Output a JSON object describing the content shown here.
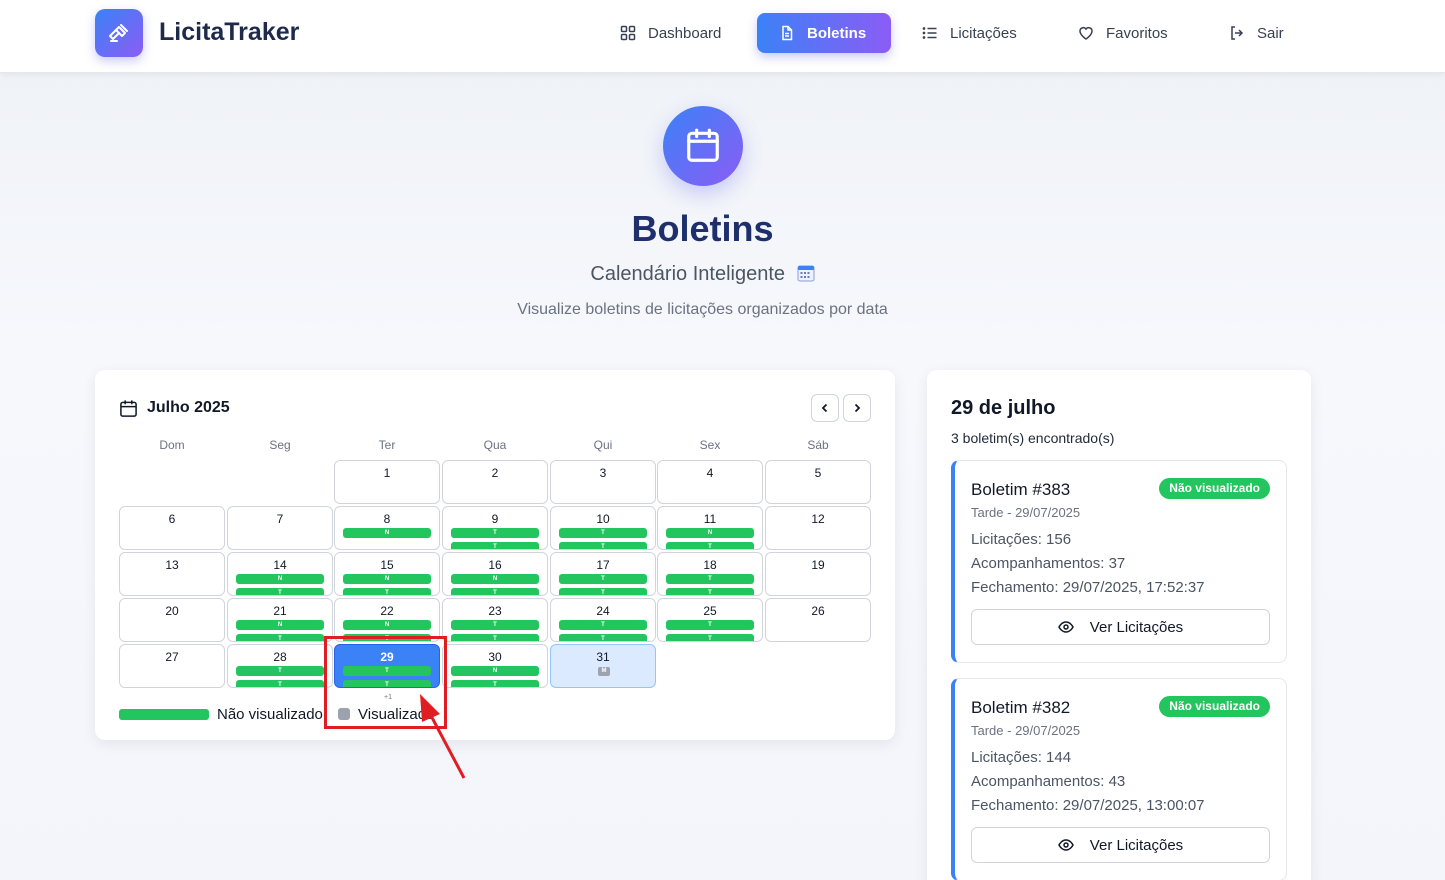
{
  "header": {
    "brand": "LicitaTraker",
    "nav": [
      {
        "label": "Dashboard",
        "icon": "dashboard-grid-icon"
      },
      {
        "label": "Boletins",
        "icon": "document-icon",
        "active": true
      },
      {
        "label": "Licitações",
        "icon": "list-icon"
      },
      {
        "label": "Favoritos",
        "icon": "heart-icon"
      },
      {
        "label": "Sair",
        "icon": "logout-icon"
      }
    ]
  },
  "hero": {
    "title": "Boletins",
    "subtitle": "Calendário Inteligente",
    "description": "Visualize boletins de licitações organizados por data"
  },
  "calendar": {
    "month_label": "Julho 2025",
    "weekdays": [
      "Dom",
      "Seg",
      "Ter",
      "Qua",
      "Qui",
      "Sex",
      "Sáb"
    ],
    "more_label": "+1",
    "legend": {
      "unviewed": "Não visualizado",
      "viewed": "Visualizado"
    },
    "bar_labels": {
      "d8": "N",
      "d9a": "T",
      "d9b": "T",
      "d10a": "T",
      "d10b": "T",
      "d11a": "N",
      "d11b": "T",
      "d14a": "N",
      "d14b": "T",
      "d15a": "N",
      "d15b": "T",
      "d16a": "N",
      "d16b": "T",
      "d17a": "T",
      "d17b": "T",
      "d18a": "T",
      "d18b": "T",
      "d21a": "N",
      "d21b": "T",
      "d22a": "N",
      "d22b": "T",
      "d23a": "T",
      "d23b": "T",
      "d24a": "T",
      "d24b": "T",
      "d25a": "T",
      "d25b": "T",
      "d28a": "T",
      "d28b": "T",
      "d29a": "T",
      "d29b": "T",
      "d30a": "N",
      "d30b": "T",
      "d31": "M"
    },
    "days": {
      "d1": "1",
      "d2": "2",
      "d3": "3",
      "d4": "4",
      "d5": "5",
      "d6": "6",
      "d7": "7",
      "d8": "8",
      "d9": "9",
      "d10": "10",
      "d11": "11",
      "d12": "12",
      "d13": "13",
      "d14": "14",
      "d15": "15",
      "d16": "16",
      "d17": "17",
      "d18": "18",
      "d19": "19",
      "d20": "20",
      "d21": "21",
      "d22": "22",
      "d23": "23",
      "d24": "24",
      "d25": "25",
      "d26": "26",
      "d27": "27",
      "d28": "28",
      "d29": "29",
      "d30": "30",
      "d31": "31"
    },
    "selected_day": "29",
    "colors": {
      "unviewed": "#22c55e",
      "viewed": "#9ca3af",
      "selected": "#3b82f6"
    }
  },
  "side": {
    "title": "29 de julho",
    "count": "3 boletim(s) encontrado(s)",
    "bulletins": [
      {
        "title": "Boletim #383",
        "badge": "Não visualizado",
        "subtitle": "Tarde - 29/07/2025",
        "licitacoes": "Licitações: 156",
        "acompanhamentos": "Acompanhamentos: 37",
        "fechamento": "Fechamento: 29/07/2025, 17:52:37",
        "button": "Ver Licitações"
      },
      {
        "title": "Boletim #382",
        "badge": "Não visualizado",
        "subtitle": "Tarde - 29/07/2025",
        "licitacoes": "Licitações: 144",
        "acompanhamentos": "Acompanhamentos: 43",
        "fechamento": "Fechamento: 29/07/2025, 13:00:07",
        "button": "Ver Licitações"
      }
    ]
  }
}
